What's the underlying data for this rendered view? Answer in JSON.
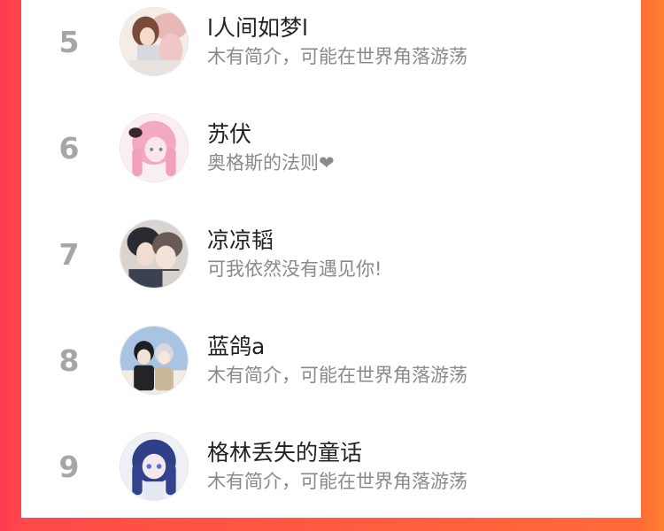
{
  "ranking": {
    "items": [
      {
        "rank": "5",
        "name": "l人间如梦l",
        "bio": "木有简介，可能在世界角落游荡"
      },
      {
        "rank": "6",
        "name": "苏伏",
        "bio": "奥格斯的法则❤"
      },
      {
        "rank": "7",
        "name": "凉凉韬",
        "bio": "可我依然没有遇见你!"
      },
      {
        "rank": "8",
        "name": "蓝鸽a",
        "bio": "木有简介，可能在世界角落游荡"
      },
      {
        "rank": "9",
        "name": "格林丢失的童话",
        "bio": "木有简介，可能在世界角落游荡"
      }
    ]
  },
  "colors": {
    "background_left": "#ff3a4e",
    "background_right": "#ff7f2e",
    "rank_text": "#a6a6a6",
    "name_text": "#222222",
    "bio_text": "#8a8a8a"
  }
}
